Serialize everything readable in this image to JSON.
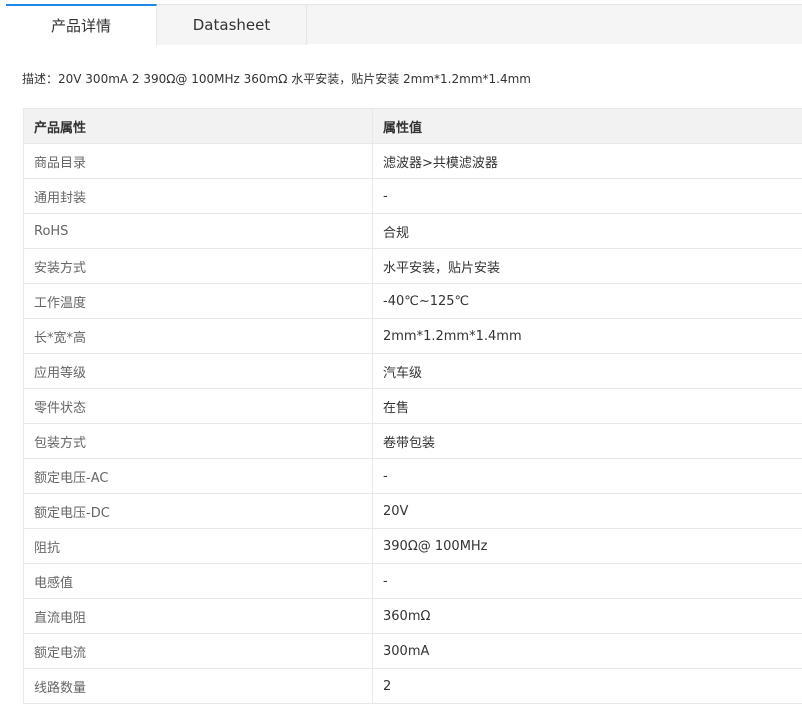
{
  "tabs": [
    {
      "label": "产品详情",
      "active": true
    },
    {
      "label": "Datasheet",
      "active": false
    }
  ],
  "description": "描述：20V 300mA 2 390Ω@ 100MHz 360mΩ 水平安装，贴片安装 2mm*1.2mm*1.4mm",
  "table": {
    "headers": [
      "产品属性",
      "属性值"
    ],
    "rows": [
      {
        "label": "商品目录",
        "value": "滤波器>共模滤波器"
      },
      {
        "label": "通用封装",
        "value": "-"
      },
      {
        "label": "RoHS",
        "value": "合规"
      },
      {
        "label": "安装方式",
        "value": "水平安装，贴片安装"
      },
      {
        "label": "工作温度",
        "value": "-40℃~125℃"
      },
      {
        "label": "长*宽*高",
        "value": "2mm*1.2mm*1.4mm"
      },
      {
        "label": "应用等级",
        "value": "汽车级"
      },
      {
        "label": "零件状态",
        "value": "在售"
      },
      {
        "label": "包装方式",
        "value": "卷带包装"
      },
      {
        "label": "额定电压-AC",
        "value": "-"
      },
      {
        "label": "额定电压-DC",
        "value": "20V"
      },
      {
        "label": "阻抗",
        "value": "390Ω@ 100MHz"
      },
      {
        "label": "电感值",
        "value": "-"
      },
      {
        "label": "直流电阻",
        "value": "360mΩ"
      },
      {
        "label": "额定电流",
        "value": "300mA"
      },
      {
        "label": "线路数量",
        "value": "2"
      }
    ]
  },
  "colors": {
    "tab_accent": "#1e88e5",
    "header_bg": "#f2f2f2",
    "border": "#e8e8e8"
  }
}
